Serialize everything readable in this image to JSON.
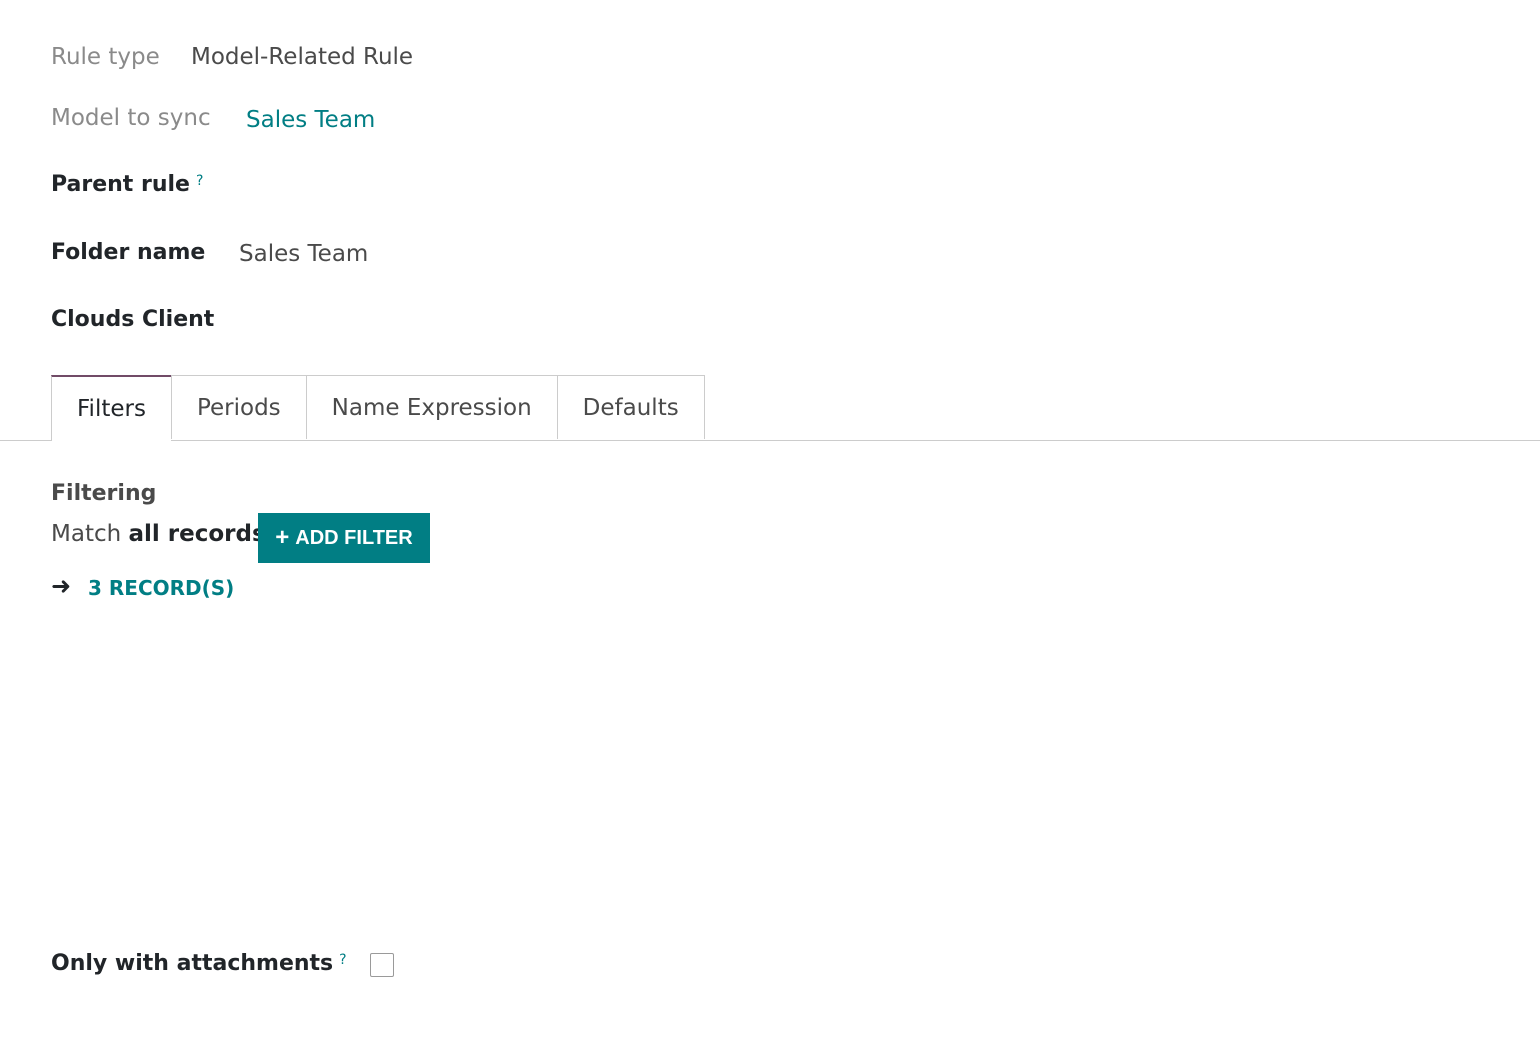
{
  "fields": {
    "rule_type": {
      "label": "Rule type",
      "value": "Model-Related Rule"
    },
    "model_to_sync": {
      "label": "Model to sync",
      "value": "Sales Team"
    },
    "parent_rule": {
      "label": "Parent rule",
      "help": "?"
    },
    "folder_name": {
      "label": "Folder name",
      "value": "Sales Team"
    },
    "clouds_client": {
      "label": "Clouds Client"
    }
  },
  "tabs": [
    {
      "label": "Filters",
      "active": true
    },
    {
      "label": "Periods",
      "active": false
    },
    {
      "label": "Name Expression",
      "active": false
    },
    {
      "label": "Defaults",
      "active": false
    }
  ],
  "filtering": {
    "title": "Filtering",
    "match_prefix": "Match",
    "match_strong": "all records",
    "add_filter_label": "ADD FILTER",
    "records_link": "3 RECORD(S)"
  },
  "attachments": {
    "label": "Only with attachments",
    "help": "?",
    "checked": false
  },
  "colors": {
    "accent": "#017e84",
    "tab_active_border": "#714b67"
  }
}
